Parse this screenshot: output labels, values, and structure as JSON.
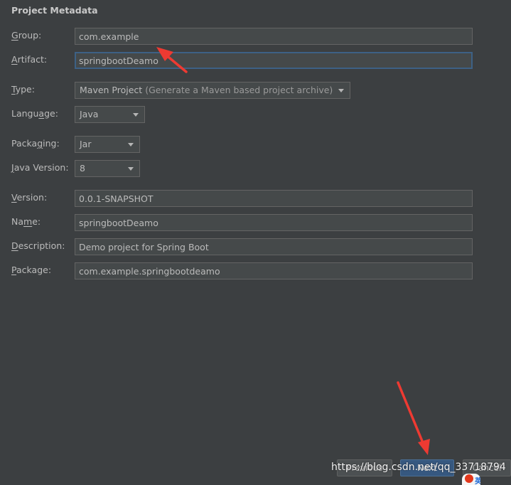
{
  "section_title": "Project Metadata",
  "fields": {
    "group": {
      "label": "Group:",
      "mnemonic": "G",
      "rest": "roup:",
      "value": "com.example"
    },
    "artifact": {
      "label": "Artifact:",
      "mnemonic": "A",
      "rest": "rtifact:",
      "value": "springbootDeamo"
    },
    "type": {
      "label": "Type:",
      "mnemonic": "T",
      "rest": "ype:",
      "value": "Maven Project",
      "hint": "(Generate a Maven based project archive)"
    },
    "language": {
      "label": "Language:",
      "pre": "Langu",
      "mnemonic": "a",
      "rest": "ge:",
      "value": "Java"
    },
    "packaging": {
      "label": "Packaging:",
      "pre": "Packa",
      "mnemonic": "g",
      "rest": "ing:",
      "value": "Jar"
    },
    "java_version": {
      "label": "Java Version:",
      "mnemonic": "J",
      "rest": "ava Version:",
      "value": "8"
    },
    "version": {
      "label": "Version:",
      "mnemonic": "V",
      "rest": "ersion:",
      "value": "0.0.1-SNAPSHOT"
    },
    "name": {
      "label": "Name:",
      "pre": "Na",
      "mnemonic": "m",
      "rest": "e:",
      "value": "springbootDeamo"
    },
    "description": {
      "label": "Description:",
      "mnemonic": "D",
      "rest": "escription:",
      "value": "Demo project for Spring Boot"
    },
    "package": {
      "label": "Package:",
      "mnemonic": "P",
      "rest": "ackage:",
      "value": "com.example.springbootdeamo"
    }
  },
  "buttons": {
    "previous": "Previous",
    "next": "Next",
    "cancel": "Cancel"
  },
  "watermark": "https://blog.csdn.net/qq_33718794",
  "logo_text": "英",
  "colors": {
    "background": "#3c3f41",
    "field_background": "#45494a",
    "focus_border": "#3d6185",
    "primary_button": "#365880",
    "annotation_arrow": "#ee3a32"
  }
}
